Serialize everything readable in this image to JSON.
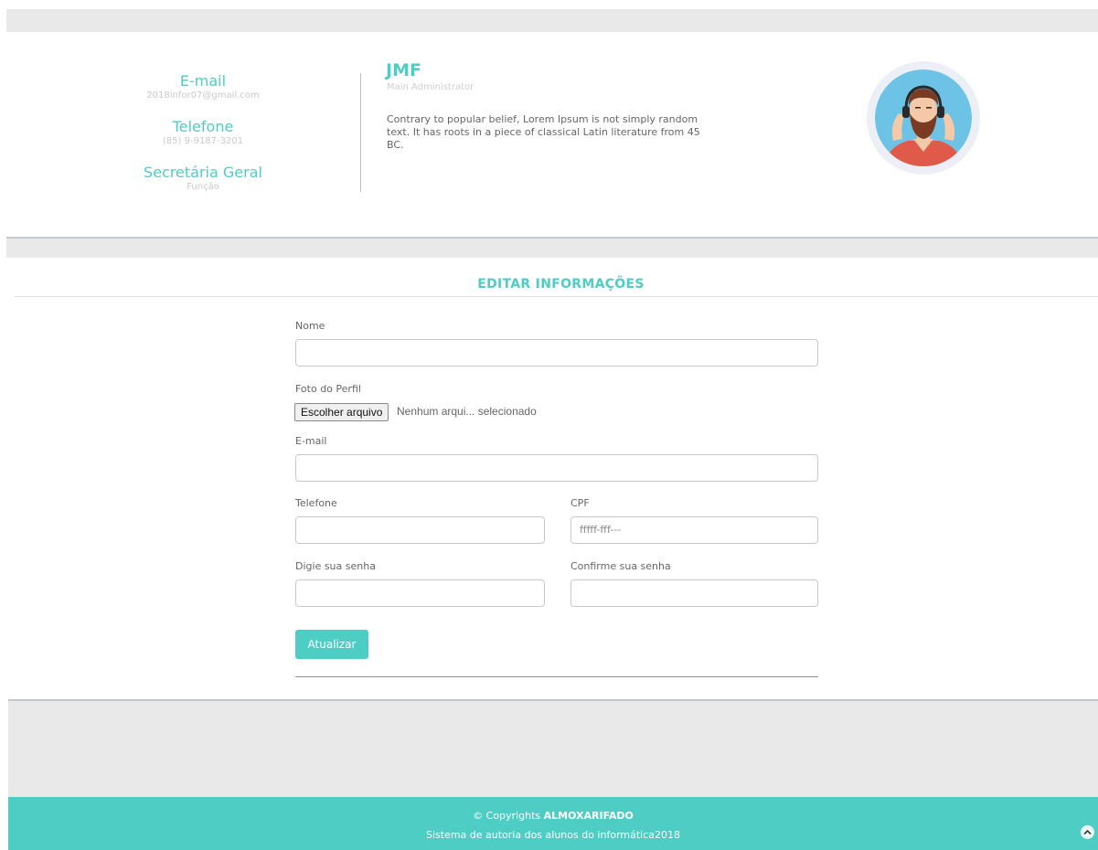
{
  "contact": {
    "email_title": "E-mail",
    "email_value": "2018infor07@gmail.com",
    "phone_title": "Telefone",
    "phone_value": "(85) 9-9187-3201",
    "role_title": "Secretária Geral",
    "role_label": "Função"
  },
  "profile": {
    "name": "JMF",
    "role": "Main Administrator",
    "bio": "Contrary to popular belief, Lorem Ipsum is not simply random text. It has roots in a piece of classical Latin literature from 45 BC."
  },
  "form": {
    "title": "EDITAR INFORMAÇÕES",
    "nome_label": "Nome",
    "foto_label": "Foto do Perfil",
    "file_button": "Escolher arquivo",
    "file_status": "Nenhum arqui... selecionado",
    "email_label": "E-mail",
    "telefone_label": "Telefone",
    "cpf_label": "CPF",
    "cpf_placeholder": "fffff-fff---",
    "senha_label": "Digie sua senha",
    "confirma_label": "Confirme sua senha",
    "submit_label": "Atualizar"
  },
  "footer": {
    "copyright_prefix": "© Copyrights ",
    "brand": "ALMOXARIFADO",
    "subtitle": "Sistema de autoria dos alunos do informática2018"
  },
  "colors": {
    "accent": "#4ecdc4",
    "band": "#e9e9e9",
    "avatar_bg": "#6cc3e6"
  },
  "icons": {
    "avatar": "bearded-man-headphones-avatar",
    "back_to_top": "chevron-up-icon"
  }
}
